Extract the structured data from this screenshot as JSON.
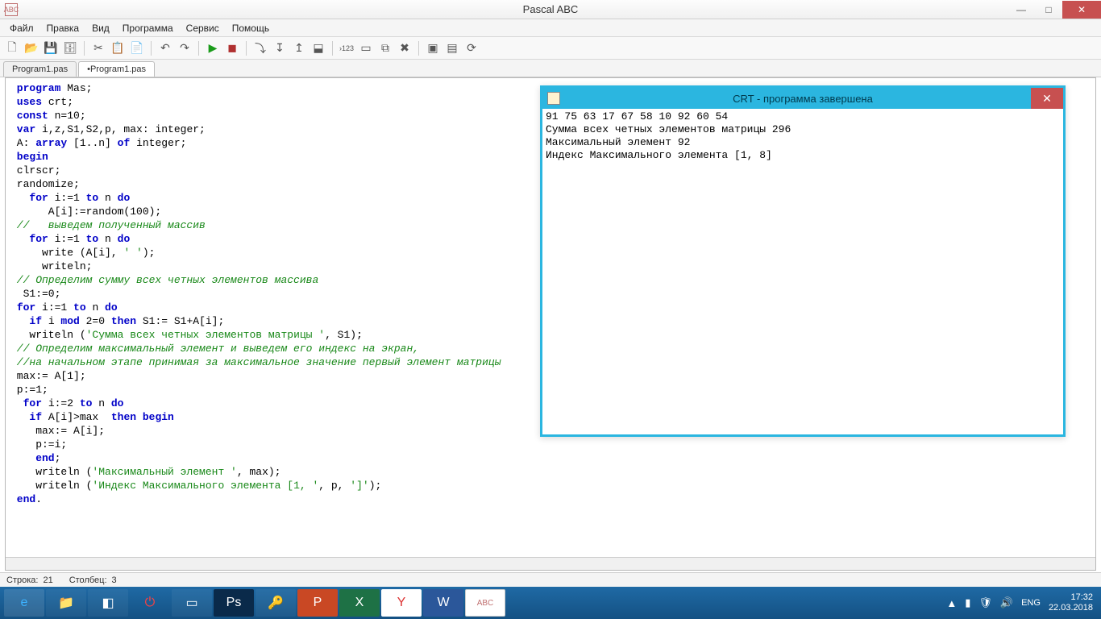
{
  "window": {
    "title": "Pascal ABC",
    "app_icon_text": "ABC"
  },
  "menu": {
    "items": [
      "Файл",
      "Правка",
      "Вид",
      "Программа",
      "Сервис",
      "Помощь"
    ]
  },
  "tabs": {
    "items": [
      "Program1.pas",
      "•Program1.pas"
    ],
    "active": 1
  },
  "code": {
    "lines": [
      {
        "t": "plain",
        "seg": [
          {
            "c": "kw",
            "v": " program"
          },
          {
            "c": "",
            "v": " Mas;"
          }
        ]
      },
      {
        "t": "plain",
        "seg": [
          {
            "c": "kw",
            "v": " uses"
          },
          {
            "c": "",
            "v": " crt;"
          }
        ]
      },
      {
        "t": "plain",
        "seg": [
          {
            "c": "kw",
            "v": " const"
          },
          {
            "c": "",
            "v": " n=10;"
          }
        ]
      },
      {
        "t": "plain",
        "seg": [
          {
            "c": "kw",
            "v": " var"
          },
          {
            "c": "",
            "v": " i,z,S1,S2,p, max: integer;"
          }
        ]
      },
      {
        "t": "plain",
        "seg": [
          {
            "c": "",
            "v": " A: "
          },
          {
            "c": "kw",
            "v": "array"
          },
          {
            "c": "",
            "v": " [1..n] "
          },
          {
            "c": "kw",
            "v": "of"
          },
          {
            "c": "",
            "v": " integer;"
          }
        ]
      },
      {
        "t": "plain",
        "seg": [
          {
            "c": "kw",
            "v": " begin"
          }
        ]
      },
      {
        "t": "plain",
        "seg": [
          {
            "c": "",
            "v": " clrscr;"
          }
        ]
      },
      {
        "t": "plain",
        "seg": [
          {
            "c": "",
            "v": " randomize;"
          }
        ]
      },
      {
        "t": "plain",
        "seg": [
          {
            "c": "",
            "v": "   "
          },
          {
            "c": "kw",
            "v": "for"
          },
          {
            "c": "",
            "v": " i:=1 "
          },
          {
            "c": "kw",
            "v": "to"
          },
          {
            "c": "",
            "v": " n "
          },
          {
            "c": "kw",
            "v": "do"
          }
        ]
      },
      {
        "t": "plain",
        "seg": [
          {
            "c": "",
            "v": "      A[i]:=random(100);"
          }
        ]
      },
      {
        "t": "plain",
        "seg": [
          {
            "c": "cm",
            "v": " //   выведем полученный массив"
          }
        ]
      },
      {
        "t": "plain",
        "seg": [
          {
            "c": "",
            "v": "   "
          },
          {
            "c": "kw",
            "v": "for"
          },
          {
            "c": "",
            "v": " i:=1 "
          },
          {
            "c": "kw",
            "v": "to"
          },
          {
            "c": "",
            "v": " n "
          },
          {
            "c": "kw",
            "v": "do"
          }
        ]
      },
      {
        "t": "plain",
        "seg": [
          {
            "c": "",
            "v": "     write (A[i], "
          },
          {
            "c": "str",
            "v": "' '"
          },
          {
            "c": "",
            "v": ");"
          }
        ]
      },
      {
        "t": "plain",
        "seg": [
          {
            "c": "",
            "v": "     writeln;"
          }
        ]
      },
      {
        "t": "plain",
        "seg": [
          {
            "c": "cm",
            "v": " // Определим сумму всех четных элементов массива"
          }
        ]
      },
      {
        "t": "plain",
        "seg": [
          {
            "c": "",
            "v": "  S1:=0;"
          }
        ]
      },
      {
        "t": "plain",
        "seg": [
          {
            "c": "",
            "v": " "
          },
          {
            "c": "kw",
            "v": "for"
          },
          {
            "c": "",
            "v": " i:=1 "
          },
          {
            "c": "kw",
            "v": "to"
          },
          {
            "c": "",
            "v": " n "
          },
          {
            "c": "kw",
            "v": "do"
          }
        ]
      },
      {
        "t": "plain",
        "seg": [
          {
            "c": "",
            "v": "   "
          },
          {
            "c": "kw",
            "v": "if"
          },
          {
            "c": "",
            "v": " i "
          },
          {
            "c": "kw",
            "v": "mod"
          },
          {
            "c": "",
            "v": " 2=0 "
          },
          {
            "c": "kw",
            "v": "then"
          },
          {
            "c": "",
            "v": " S1:= S1+A[i];"
          }
        ]
      },
      {
        "t": "plain",
        "seg": [
          {
            "c": "",
            "v": "   writeln ("
          },
          {
            "c": "str",
            "v": "'Сумма всех четных элементов матрицы '"
          },
          {
            "c": "",
            "v": ", S1);"
          }
        ]
      },
      {
        "t": "plain",
        "seg": [
          {
            "c": "cm",
            "v": " // Определим максимальный элемент и выведем его индекс на экран,"
          }
        ]
      },
      {
        "t": "plain",
        "seg": [
          {
            "c": "cm",
            "v": " //на начальном этапе принимая за максимальное значение первый элемент матрицы"
          }
        ]
      },
      {
        "t": "plain",
        "seg": [
          {
            "c": "",
            "v": " max:= A[1];"
          }
        ]
      },
      {
        "t": "plain",
        "seg": [
          {
            "c": "",
            "v": " p:=1;"
          }
        ]
      },
      {
        "t": "plain",
        "seg": [
          {
            "c": "",
            "v": "  "
          },
          {
            "c": "kw",
            "v": "for"
          },
          {
            "c": "",
            "v": " i:=2 "
          },
          {
            "c": "kw",
            "v": "to"
          },
          {
            "c": "",
            "v": " n "
          },
          {
            "c": "kw",
            "v": "do"
          }
        ]
      },
      {
        "t": "plain",
        "seg": [
          {
            "c": "",
            "v": "   "
          },
          {
            "c": "kw",
            "v": "if"
          },
          {
            "c": "",
            "v": " A[i]>max  "
          },
          {
            "c": "kw",
            "v": "then begin"
          }
        ]
      },
      {
        "t": "plain",
        "seg": [
          {
            "c": "",
            "v": "    max:= A[i];"
          }
        ]
      },
      {
        "t": "plain",
        "seg": [
          {
            "c": "",
            "v": "    p:=i;"
          }
        ]
      },
      {
        "t": "plain",
        "seg": [
          {
            "c": "kw",
            "v": "    end"
          },
          {
            "c": "",
            "v": ";"
          }
        ]
      },
      {
        "t": "plain",
        "seg": [
          {
            "c": "",
            "v": "    writeln ("
          },
          {
            "c": "str",
            "v": "'Максимальный элемент '"
          },
          {
            "c": "",
            "v": ", max);"
          }
        ]
      },
      {
        "t": "plain",
        "seg": [
          {
            "c": "",
            "v": "    writeln ("
          },
          {
            "c": "str",
            "v": "'Индекс Максимального элемента [1, '"
          },
          {
            "c": "",
            "v": ", p, "
          },
          {
            "c": "str",
            "v": "']'"
          },
          {
            "c": "",
            "v": ");"
          }
        ]
      },
      {
        "t": "plain",
        "seg": [
          {
            "c": "kw",
            "v": " end"
          },
          {
            "c": "",
            "v": "."
          }
        ]
      }
    ]
  },
  "crt": {
    "title": "CRT - программа завершена",
    "output": [
      "91 75 63 17 67 58 10 92 60 54",
      "Сумма всех четных элементов матрицы 296",
      "Максимальный элемент 92",
      "Индекс Максимального элемента [1, 8]"
    ]
  },
  "status": {
    "line_label": "Строка:",
    "line_value": "21",
    "col_label": "Столбец:",
    "col_value": "3"
  },
  "taskbar": {
    "lang": "ENG",
    "time": "17:32",
    "date": "22.03.2018"
  }
}
